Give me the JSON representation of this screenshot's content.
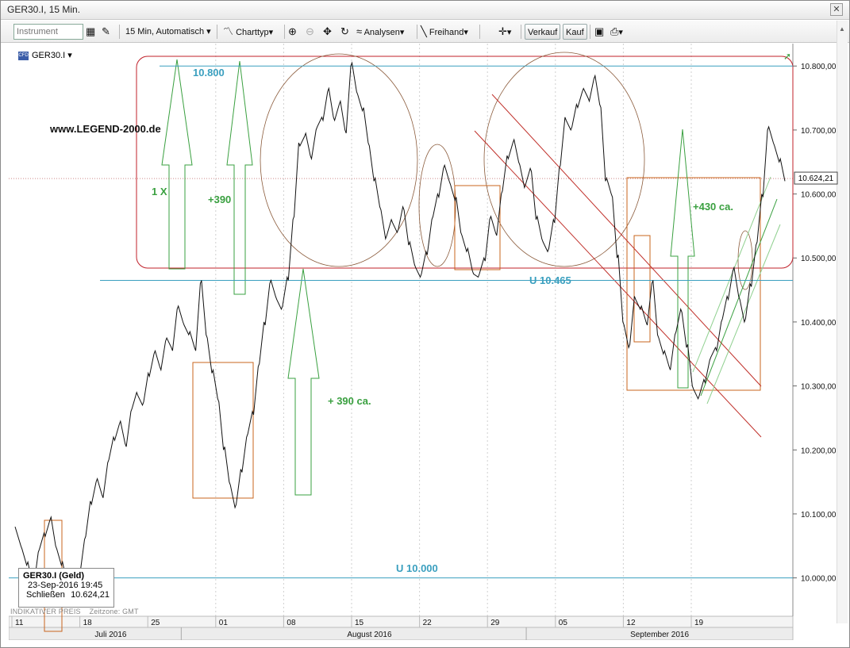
{
  "window": {
    "title": "GER30.I, 15 Min."
  },
  "toolbar": {
    "instrument_placeholder": "Instrument",
    "interval": "15 Min,",
    "mode": "Automatisch",
    "charttype": "Charttyp",
    "analysen": "Analysen",
    "freihand": "Freihand",
    "verkauf": "Verkauf",
    "kauf": "Kauf"
  },
  "chart": {
    "instrument": "GER30.I",
    "price_tag": "10.624,21",
    "watermark": "www.LEGEND-2000.de"
  },
  "infobox": {
    "title": "GER30.I (Geld)",
    "datetime": "23-Sep-2016 19:45",
    "close_label": "Schließen",
    "close_value": "10.624,21"
  },
  "footer": {
    "indikativ": "INDIKATIVER PREIS",
    "zeitzone": "Zeitzone: GMT"
  },
  "chart_data": {
    "type": "line",
    "x_ticks": [
      "11",
      "18",
      "25",
      "01",
      "08",
      "15",
      "22",
      "29",
      "05",
      "12",
      "19"
    ],
    "months": [
      "Juli 2016",
      "August 2016",
      "September 2016"
    ],
    "y_ticks": [
      "10.000,00",
      "10.100,00",
      "10.200,00",
      "10.300,00",
      "10.400,00",
      "10.500,00",
      "10.600,00",
      "10.700,00",
      "10.800,00"
    ],
    "ylim": [
      9940,
      10835
    ],
    "last_price": 10624.21,
    "horizontal_lines": [
      {
        "value": 10800,
        "label": "10.800",
        "color": "#3a9fbf"
      },
      {
        "value": 10465,
        "label": "U 10.465",
        "color": "#3a9fbf"
      },
      {
        "value": 10000,
        "label": "U 10.000",
        "color": "#3a9fbf"
      }
    ],
    "annotations": [
      {
        "text": "1 X",
        "color": "#3aa040"
      },
      {
        "text": "+390",
        "color": "#3aa040"
      },
      {
        "text": "+ 390 ca.",
        "color": "#3aa040"
      },
      {
        "text": "+430 ca.",
        "color": "#3aa040"
      }
    ],
    "series": [
      {
        "values": [
          10080,
          10050,
          10020,
          9990,
          10040,
          10070,
          10090,
          10050,
          10020,
          9990,
          9960,
          10010,
          10060,
          10120,
          10150,
          10130,
          10180,
          10220,
          10240,
          10210,
          10260,
          10290,
          10270,
          10320,
          10350,
          10330,
          10370,
          10360,
          10420,
          10400,
          10380,
          10360,
          10460,
          10380,
          10320,
          10280,
          10200,
          10150,
          10110,
          10170,
          10220,
          10260,
          10330,
          10400,
          10460,
          10440,
          10420,
          10470,
          10560,
          10680,
          10690,
          10660,
          10700,
          10720,
          10760,
          10720,
          10740,
          10700,
          10800,
          10760,
          10730,
          10680,
          10620,
          10580,
          10530,
          10560,
          10540,
          10580,
          10520,
          10490,
          10470,
          10510,
          10560,
          10600,
          10640,
          10620,
          10590,
          10540,
          10510,
          10480,
          10470,
          10500,
          10560,
          10540,
          10600,
          10660,
          10680,
          10650,
          10610,
          10640,
          10560,
          10530,
          10510,
          10560,
          10640,
          10720,
          10700,
          10740,
          10760,
          10750,
          10780,
          10740,
          10620,
          10600,
          10500,
          10400,
          10360,
          10440,
          10420,
          10400,
          10460,
          10380,
          10350,
          10330,
          10380,
          10420,
          10360,
          10300,
          10280,
          10310,
          10340,
          10360,
          10400,
          10440,
          10480,
          10440,
          10400,
          10460,
          10520,
          10600,
          10700,
          10680,
          10650,
          10620
        ]
      }
    ]
  }
}
